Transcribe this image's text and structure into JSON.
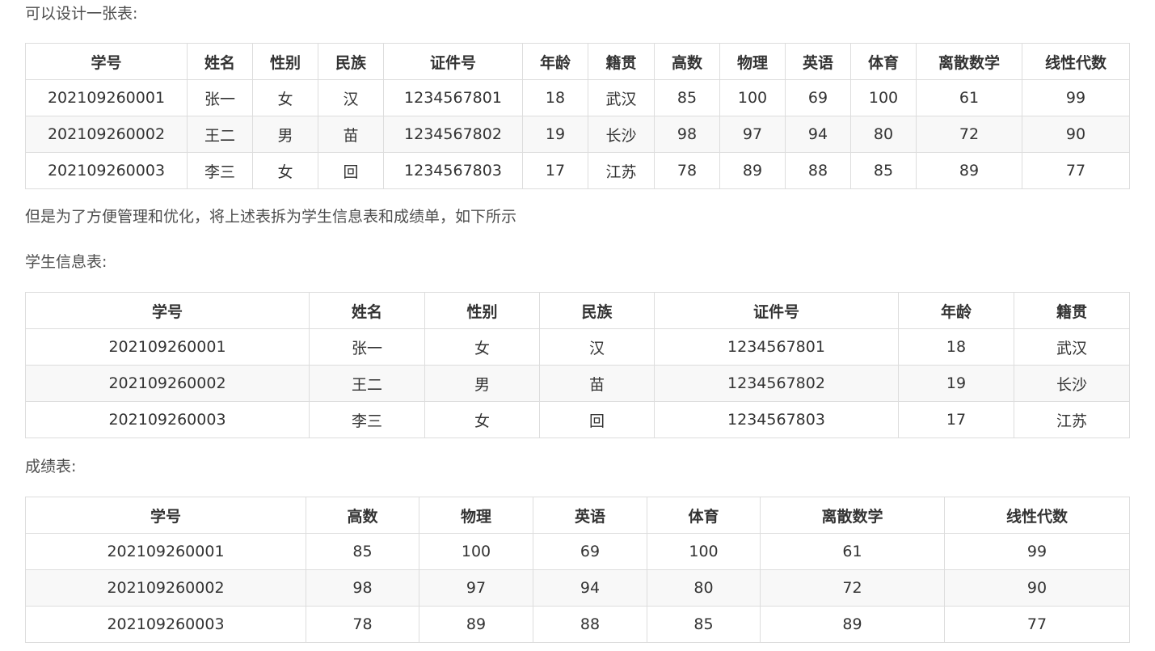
{
  "intro": "可以设计一张表:",
  "full_table": {
    "headers": [
      "学号",
      "姓名",
      "性别",
      "民族",
      "证件号",
      "年龄",
      "籍贯",
      "高数",
      "物理",
      "英语",
      "体育",
      "离散数学",
      "线性代数"
    ],
    "rows": [
      [
        "202109260001",
        "张一",
        "女",
        "汉",
        "1234567801",
        "18",
        "武汉",
        "85",
        "100",
        "69",
        "100",
        "61",
        "99"
      ],
      [
        "202109260002",
        "王二",
        "男",
        "苗",
        "1234567802",
        "19",
        "长沙",
        "98",
        "97",
        "94",
        "80",
        "72",
        "90"
      ],
      [
        "202109260003",
        "李三",
        "女",
        "回",
        "1234567803",
        "17",
        "江苏",
        "78",
        "89",
        "88",
        "85",
        "89",
        "77"
      ]
    ]
  },
  "split_note": "但是为了方便管理和优化，将上述表拆为学生信息表和成绩单，如下所示",
  "info_label": "学生信息表:",
  "info_table": {
    "headers": [
      "学号",
      "姓名",
      "性别",
      "民族",
      "证件号",
      "年龄",
      "籍贯"
    ],
    "rows": [
      [
        "202109260001",
        "张一",
        "女",
        "汉",
        "1234567801",
        "18",
        "武汉"
      ],
      [
        "202109260002",
        "王二",
        "男",
        "苗",
        "1234567802",
        "19",
        "长沙"
      ],
      [
        "202109260003",
        "李三",
        "女",
        "回",
        "1234567803",
        "17",
        "江苏"
      ]
    ]
  },
  "score_label": "成绩表:",
  "score_table": {
    "headers": [
      "学号",
      "高数",
      "物理",
      "英语",
      "体育",
      "离散数学",
      "线性代数"
    ],
    "rows": [
      [
        "202109260001",
        "85",
        "100",
        "69",
        "100",
        "61",
        "99"
      ],
      [
        "202109260002",
        "98",
        "97",
        "94",
        "80",
        "72",
        "90"
      ],
      [
        "202109260003",
        "78",
        "89",
        "88",
        "85",
        "89",
        "77"
      ]
    ]
  }
}
